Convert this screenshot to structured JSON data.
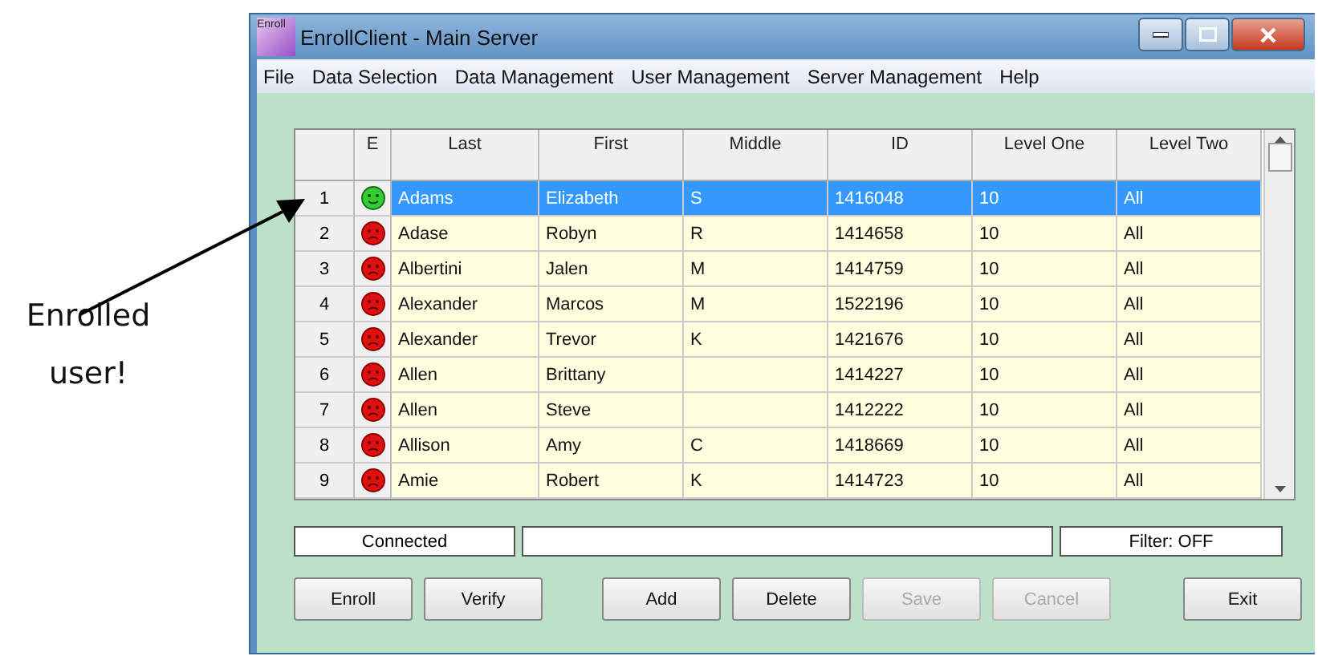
{
  "annotation": {
    "text": "Enrolled user!"
  },
  "window": {
    "title": "EnrollClient - Main Server",
    "icon_text": "Enroll"
  },
  "menu": [
    {
      "label": "File"
    },
    {
      "label": "Data Selection"
    },
    {
      "label": "Data Management"
    },
    {
      "label": "User Management"
    },
    {
      "label": "Server Management"
    },
    {
      "label": "Help"
    }
  ],
  "table": {
    "enrolled_column": "E",
    "columns": [
      "Last",
      "First",
      "Middle",
      "ID",
      "Level One",
      "Level Two"
    ],
    "rows": [
      {
        "number": "1",
        "enrolled": true,
        "selected": true,
        "cells": [
          "Adams",
          "Elizabeth",
          "S",
          "1416048",
          "10",
          "All"
        ]
      },
      {
        "number": "2",
        "enrolled": false,
        "selected": false,
        "cells": [
          "Adase",
          "Robyn",
          "R",
          "1414658",
          "10",
          "All"
        ]
      },
      {
        "number": "3",
        "enrolled": false,
        "selected": false,
        "cells": [
          "Albertini",
          "Jalen",
          "M",
          "1414759",
          "10",
          "All"
        ]
      },
      {
        "number": "4",
        "enrolled": false,
        "selected": false,
        "cells": [
          "Alexander",
          "Marcos",
          "M",
          "1522196",
          "10",
          "All"
        ]
      },
      {
        "number": "5",
        "enrolled": false,
        "selected": false,
        "cells": [
          "Alexander",
          "Trevor",
          "K",
          "1421676",
          "10",
          "All"
        ]
      },
      {
        "number": "6",
        "enrolled": false,
        "selected": false,
        "cells": [
          "Allen",
          "Brittany",
          "",
          "1414227",
          "10",
          "All"
        ]
      },
      {
        "number": "7",
        "enrolled": false,
        "selected": false,
        "cells": [
          "Allen",
          "Steve",
          "",
          "1412222",
          "10",
          "All"
        ]
      },
      {
        "number": "8",
        "enrolled": false,
        "selected": false,
        "cells": [
          "Allison",
          "Amy",
          "C",
          "1418669",
          "10",
          "All"
        ]
      },
      {
        "number": "9",
        "enrolled": false,
        "selected": false,
        "cells": [
          "Amie",
          "Robert",
          "K",
          "1414723",
          "10",
          "All"
        ]
      }
    ]
  },
  "status_bar": {
    "connection": "Connected",
    "filter": "Filter: OFF"
  },
  "buttons": [
    {
      "label": "Enroll",
      "disabled": false
    },
    {
      "label": "Verify",
      "disabled": false
    },
    {
      "label": "Add",
      "disabled": false
    },
    {
      "label": "Delete",
      "disabled": false
    },
    {
      "label": "Save",
      "disabled": true
    },
    {
      "label": "Cancel",
      "disabled": true
    },
    {
      "label": "Exit",
      "disabled": false
    }
  ]
}
